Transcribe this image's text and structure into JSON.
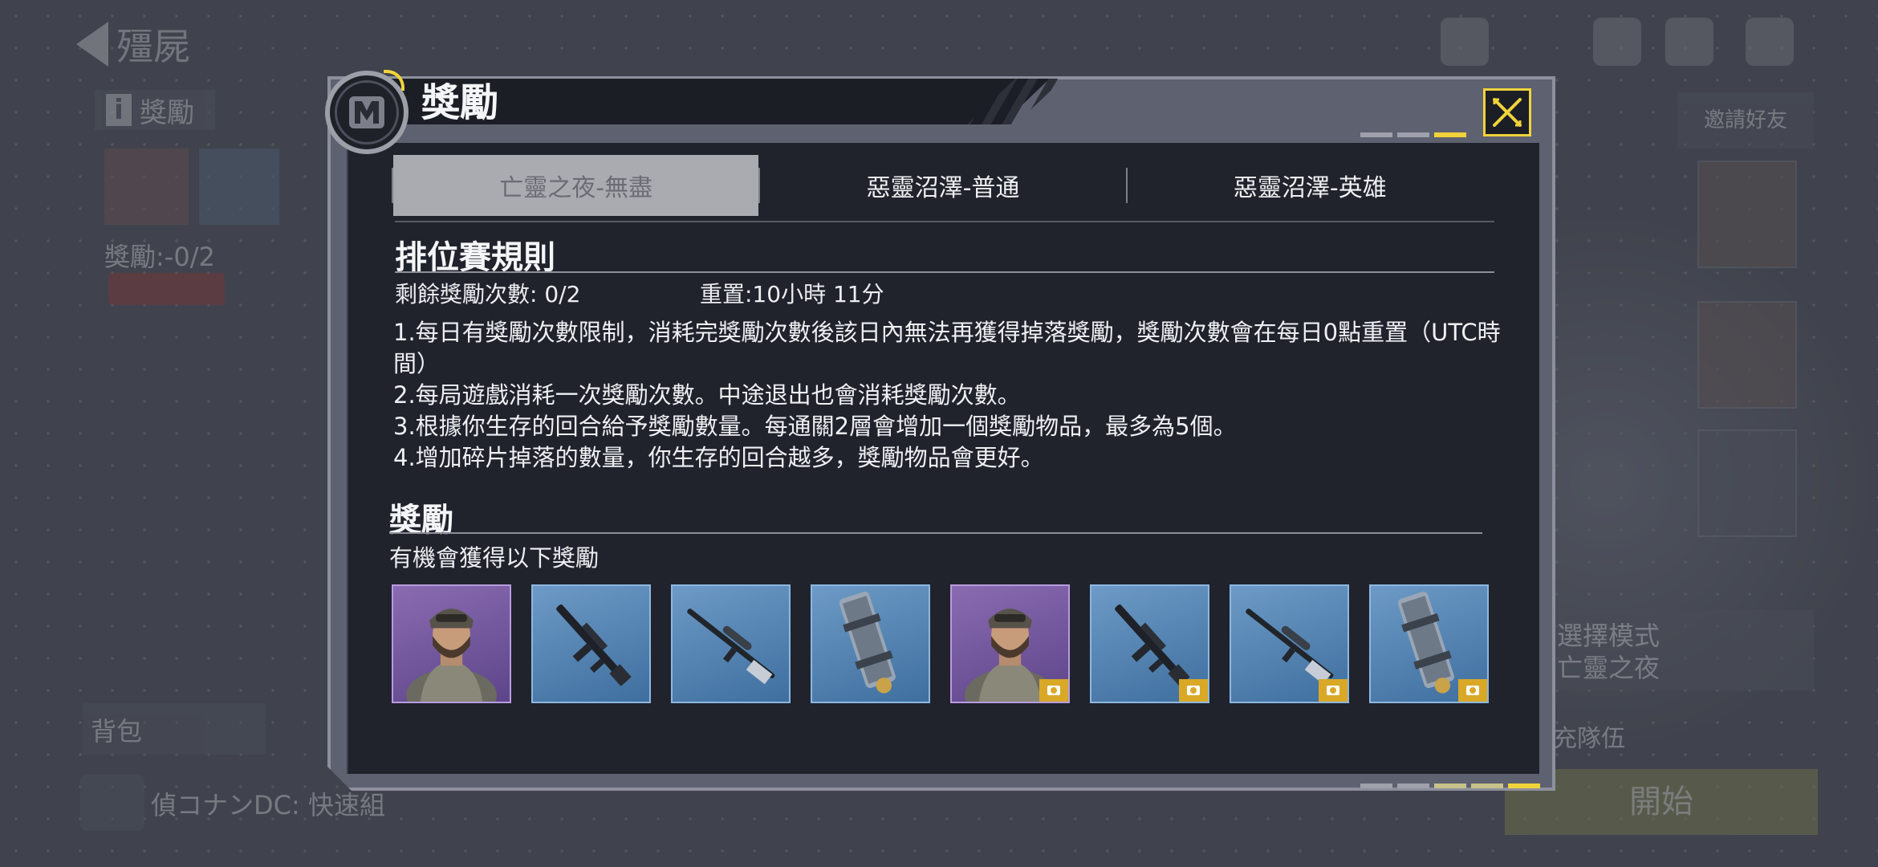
{
  "background": {
    "mode_title": "殭屍",
    "info_label": "獎勵",
    "reward_count": "獎勵:-0/2",
    "bag_label": "背包",
    "chat_text": "偵コナンDC: 快速組",
    "invite_label": "邀請好友",
    "mode_line1": "選擇模式",
    "mode_line2": "亡靈之夜",
    "fill_label": "補充隊伍",
    "start_label": "開始"
  },
  "dialog": {
    "title": "獎勵",
    "close_icon": "close-icon",
    "tabs": [
      {
        "label": "亡靈之夜-無盡",
        "active": true
      },
      {
        "label": "惡靈沼澤-普通",
        "active": false
      },
      {
        "label": "惡靈沼澤-英雄",
        "active": false
      }
    ],
    "rules_heading": "排位賽規則",
    "remaining_label": "剩餘獎勵次數: 0/2",
    "reset_label": "重置:10小時 11分",
    "rules": [
      "1.每日有獎勵次數限制，消耗完獎勵次數後該日內無法再獲得掉落獎勵，獎勵次數會在每日0點重置（UTC時間）",
      "2.每局遊戲消耗一次獎勵次數。中途退出也會消耗獎勵次數。",
      "3.根據你生存的回合給予獎勵數量。每通關2層會增加一個獎勵物品，最多為5個。",
      "4.增加碎片掉落的數量，你生存的回合越多，獎勵物品會更好。"
    ],
    "rewards_heading": "獎勵",
    "rewards_sub": "有機會獲得以下獎勵",
    "items": [
      {
        "icon": "soldier-portrait-icon",
        "rarity": "epic",
        "badge": false
      },
      {
        "icon": "assault-rifle-icon",
        "rarity": "rare",
        "badge": false
      },
      {
        "icon": "sniper-rifle-icon",
        "rarity": "rare",
        "badge": false
      },
      {
        "icon": "launcher-icon",
        "rarity": "rare",
        "badge": false
      },
      {
        "icon": "soldier-portrait-icon",
        "rarity": "epic",
        "badge": true
      },
      {
        "icon": "assault-rifle-icon",
        "rarity": "rare",
        "badge": true
      },
      {
        "icon": "sniper-rifle-icon",
        "rarity": "rare",
        "badge": true
      },
      {
        "icon": "launcher-icon",
        "rarity": "rare",
        "badge": true
      }
    ],
    "colors": {
      "accent": "#f0d33a",
      "rare": "#4f7fb0",
      "epic": "#7455a0",
      "badge": "#d9a827"
    }
  }
}
